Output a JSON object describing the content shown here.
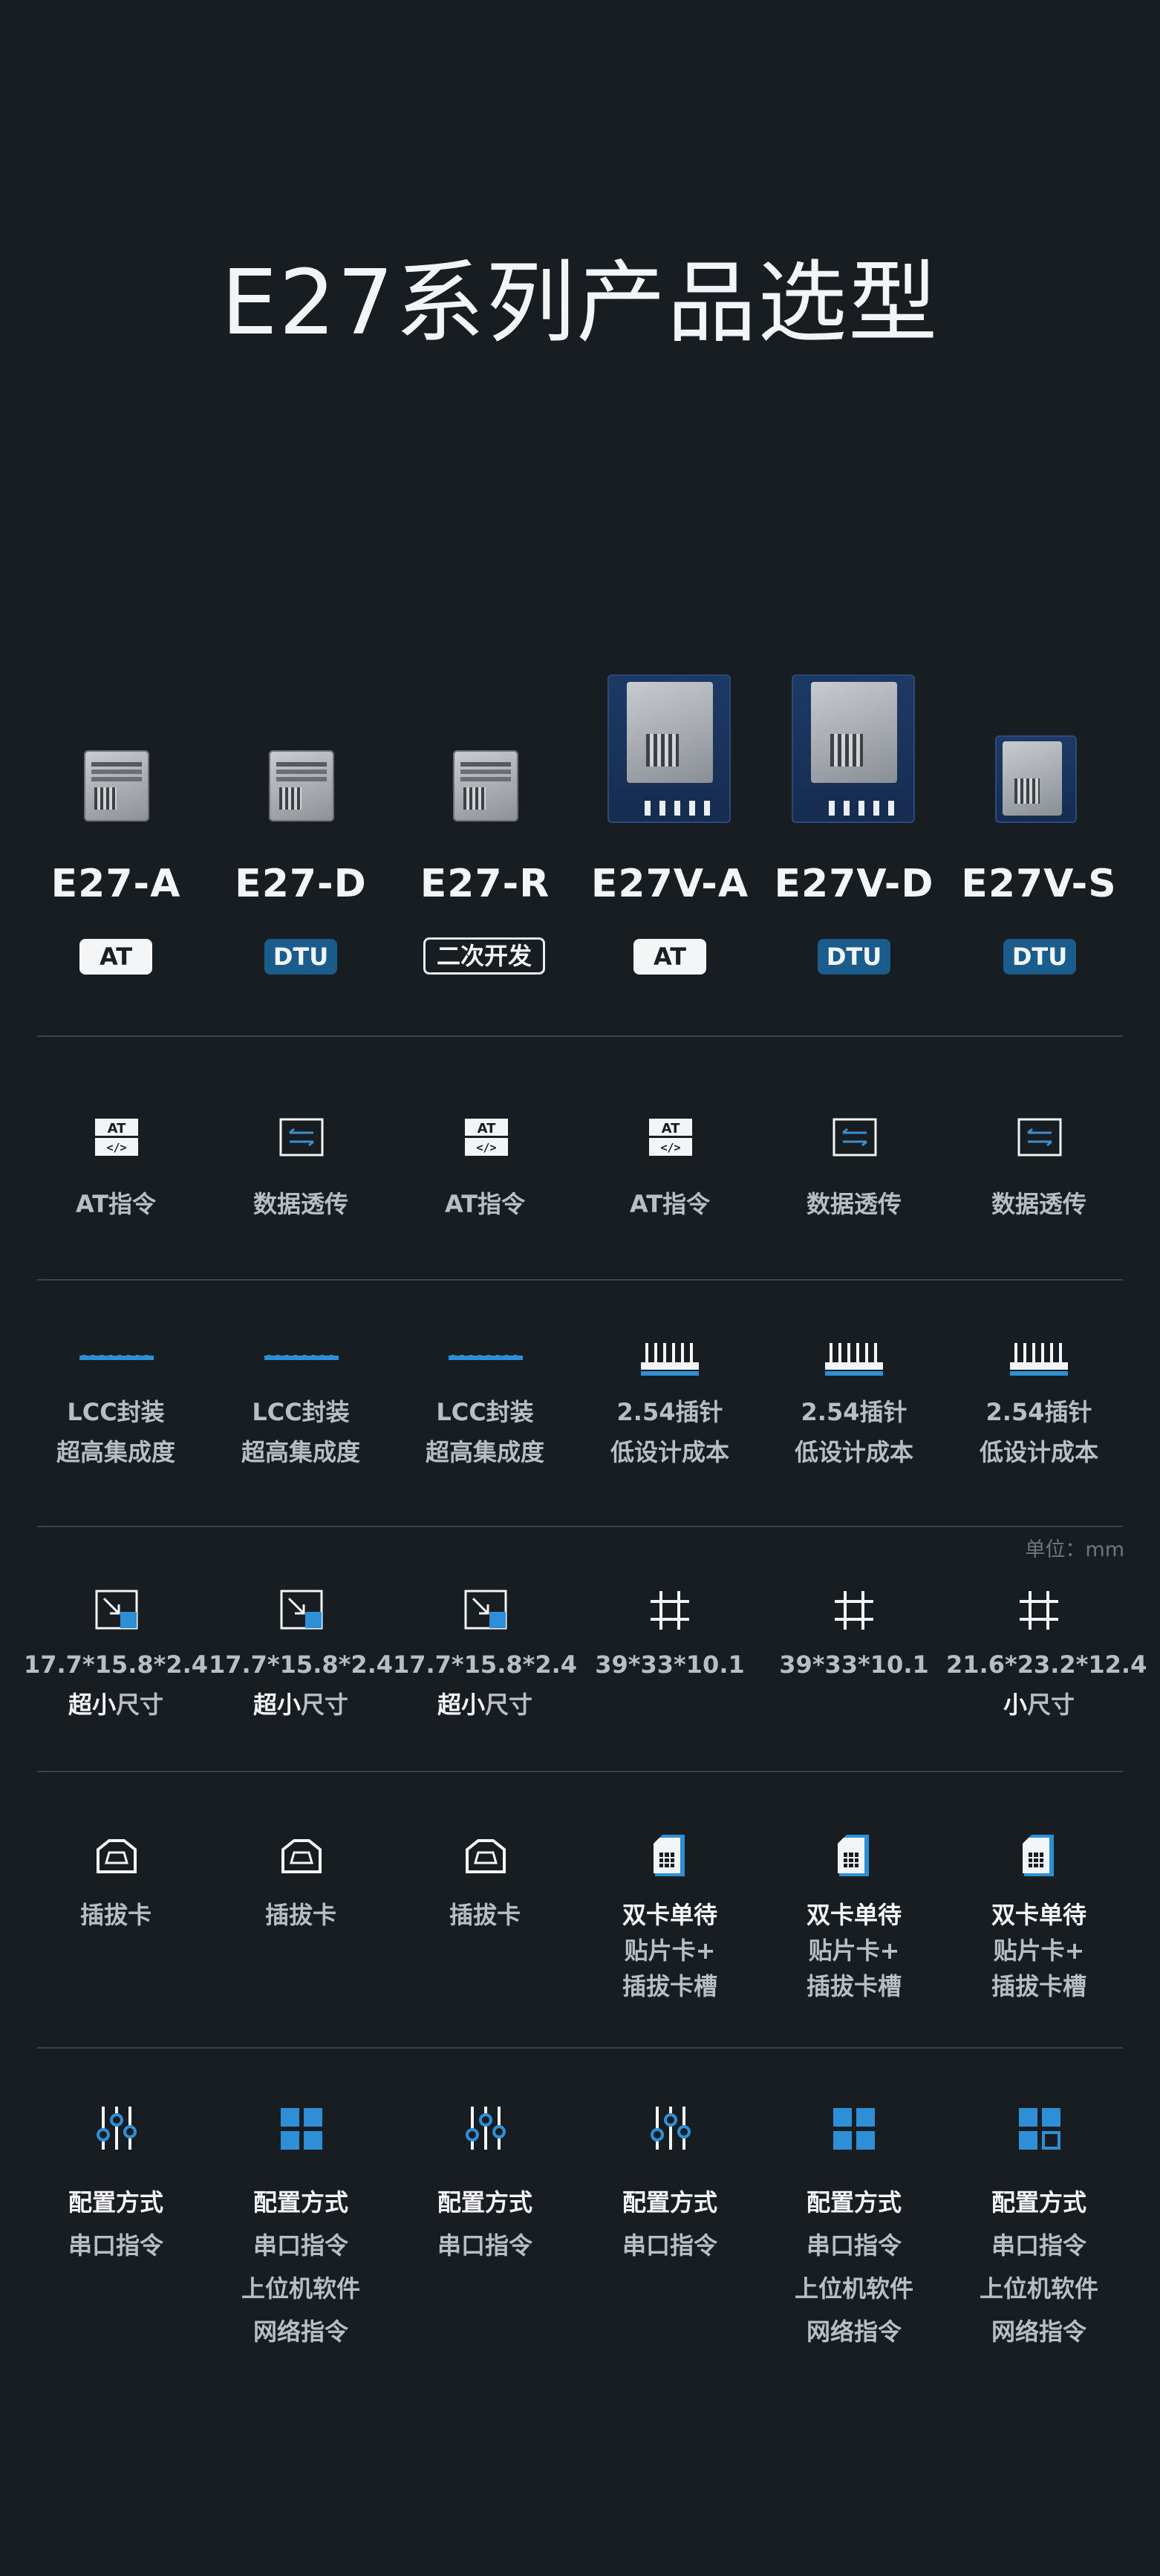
{
  "title": "E27系列产品选型",
  "products": [
    {
      "name": "E27-A",
      "badge": "AT",
      "badge_type": "at"
    },
    {
      "name": "E27-D",
      "badge": "DTU",
      "badge_type": "dtu"
    },
    {
      "name": "E27-R",
      "badge": "二次开发",
      "badge_type": "dev"
    },
    {
      "name": "E27V-A",
      "badge": "AT",
      "badge_type": "at"
    },
    {
      "name": "E27V-D",
      "badge": "DTU",
      "badge_type": "dtu"
    },
    {
      "name": "E27V-S",
      "badge": "DTU",
      "badge_type": "dtu"
    }
  ],
  "protocol": [
    {
      "icon": "at-command-icon",
      "label": "AT指令"
    },
    {
      "icon": "data-transparent-icon",
      "label": "数据透传"
    },
    {
      "icon": "at-command-icon",
      "label": "AT指令"
    },
    {
      "icon": "at-command-icon",
      "label": "AT指令"
    },
    {
      "icon": "data-transparent-icon",
      "label": "数据透传"
    },
    {
      "icon": "data-transparent-icon",
      "label": "数据透传"
    }
  ],
  "package": [
    {
      "icon": "lcc-package-icon",
      "line1": "LCC封装",
      "line2": "超高集成度"
    },
    {
      "icon": "lcc-package-icon",
      "line1": "LCC封装",
      "line2": "超高集成度"
    },
    {
      "icon": "lcc-package-icon",
      "line1": "LCC封装",
      "line2": "超高集成度"
    },
    {
      "icon": "pin-header-icon",
      "line1": "2.54插针",
      "line2": "低设计成本"
    },
    {
      "icon": "pin-header-icon",
      "line1": "2.54插针",
      "line2": "低设计成本"
    },
    {
      "icon": "pin-header-icon",
      "line1": "2.54插针",
      "line2": "低设计成本"
    }
  ],
  "unit_label": "单位：mm",
  "size": [
    {
      "icon": "compact-size-icon",
      "dims": "17.7*15.8*2.4",
      "emph": "超小",
      "rest": "尺寸"
    },
    {
      "icon": "compact-size-icon",
      "dims": "17.7*15.8*2.4",
      "emph": "超小",
      "rest": "尺寸"
    },
    {
      "icon": "compact-size-icon",
      "dims": "17.7*15.8*2.4",
      "emph": "超小",
      "rest": "尺寸"
    },
    {
      "icon": "grid-size-icon",
      "dims": "39*33*10.1",
      "emph": "",
      "rest": ""
    },
    {
      "icon": "grid-size-icon",
      "dims": "39*33*10.1",
      "emph": "",
      "rest": ""
    },
    {
      "icon": "grid-size-icon",
      "dims": "21.6*23.2*12.4",
      "emph": "小",
      "rest": "尺寸"
    }
  ],
  "card": [
    {
      "icon": "card-slot-icon",
      "line1": "插拔卡",
      "line2": "",
      "line3": ""
    },
    {
      "icon": "card-slot-icon",
      "line1": "插拔卡",
      "line2": "",
      "line3": ""
    },
    {
      "icon": "card-slot-icon",
      "line1": "插拔卡",
      "line2": "",
      "line3": ""
    },
    {
      "icon": "sim-card-icon",
      "line1": "双卡单待",
      "line2": "贴片卡+",
      "line3": "插拔卡槽"
    },
    {
      "icon": "sim-card-icon",
      "line1": "双卡单待",
      "line2": "贴片卡+",
      "line3": "插拔卡槽"
    },
    {
      "icon": "sim-card-icon",
      "line1": "双卡单待",
      "line2": "贴片卡+",
      "line3": "插拔卡槽"
    }
  ],
  "config": [
    {
      "icon": "sliders-icon",
      "head": "配置方式",
      "l1": "串口指令",
      "l2": "",
      "l3": ""
    },
    {
      "icon": "tiles-icon",
      "head": "配置方式",
      "l1": "串口指令",
      "l2": "上位机软件",
      "l3": "网络指令"
    },
    {
      "icon": "sliders-icon",
      "head": "配置方式",
      "l1": "串口指令",
      "l2": "",
      "l3": ""
    },
    {
      "icon": "sliders-icon",
      "head": "配置方式",
      "l1": "串口指令",
      "l2": "",
      "l3": ""
    },
    {
      "icon": "tiles-icon",
      "head": "配置方式",
      "l1": "串口指令",
      "l2": "上位机软件",
      "l3": "网络指令"
    },
    {
      "icon": "tiles-outline-icon",
      "head": "配置方式",
      "l1": "串口指令",
      "l2": "上位机软件",
      "l3": "网络指令"
    }
  ],
  "colors": {
    "background": "#181d22",
    "accent": "#1a5c8c",
    "divider": "#3d434a"
  }
}
